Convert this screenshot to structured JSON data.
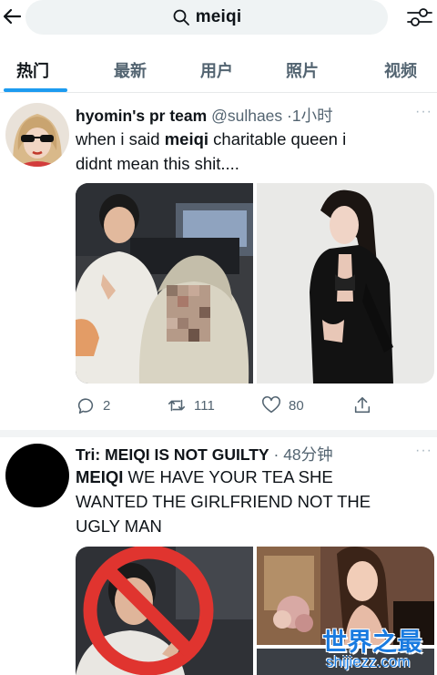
{
  "search": {
    "query": "meiqi"
  },
  "tabs": [
    {
      "label": "热门",
      "active": true
    },
    {
      "label": "最新"
    },
    {
      "label": "用户"
    },
    {
      "label": "照片"
    },
    {
      "label": "视频"
    }
  ],
  "tweets": [
    {
      "name": "hyomin's pr team",
      "handle": "@sulhaes",
      "sep": "·",
      "time": "1小时",
      "lines": [
        [
          "when i said ",
          "meiqi",
          " charitable queen i"
        ],
        [
          "didnt mean this shit...."
        ]
      ],
      "replies": "2",
      "retweets": "111",
      "likes": "80"
    },
    {
      "name": "Tri: MEIQI IS NOT GUILTY",
      "sep": "·",
      "time": "48分钟",
      "lines": [
        [
          "MEIQI",
          " WE HAVE YOUR TEA SHE"
        ],
        [
          "WANTED THE GIRLFRIEND NOT THE"
        ],
        [
          "UGLY MAN"
        ]
      ]
    }
  ],
  "more_glyph": "···",
  "watermark": {
    "title": "世界之最",
    "url": "shijiezz.com"
  },
  "colors": {
    "accent": "#1d9bf0",
    "text": "#0f1419",
    "muted": "#536471"
  }
}
